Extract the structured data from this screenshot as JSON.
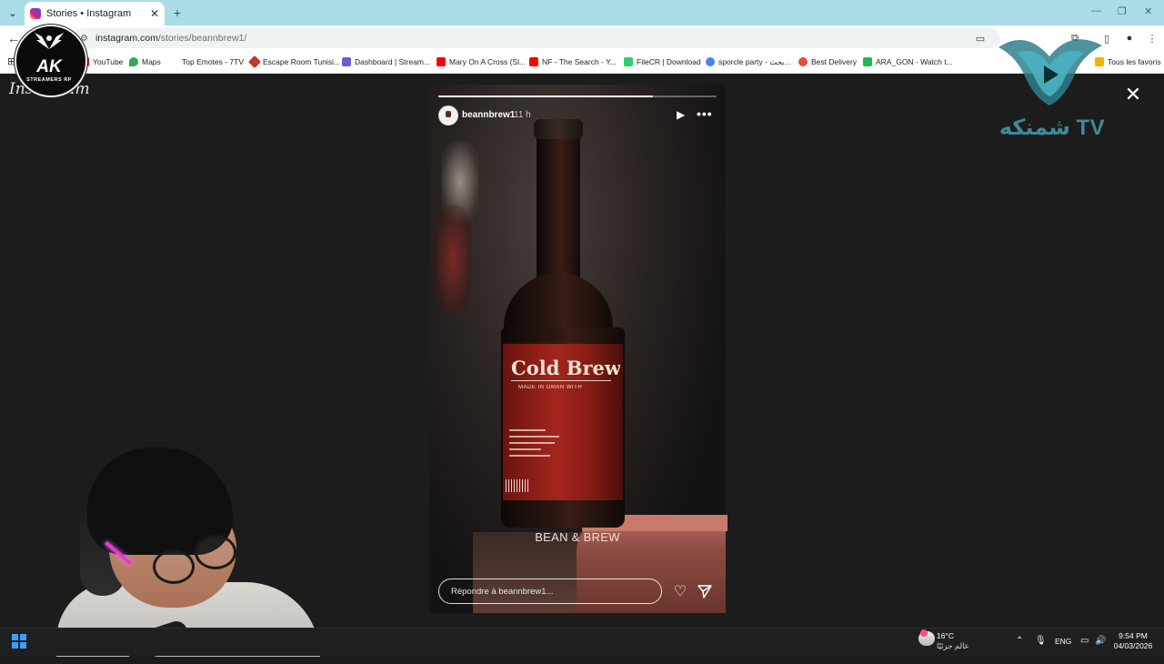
{
  "browser": {
    "tab_title": "Stories • Instagram",
    "tab_close": "✕",
    "new_tab": "+",
    "url_host": "instagram.com",
    "url_path": "/stories/beannbrew1/",
    "bookmarks": [
      {
        "label": "YouTube",
        "color": "#ff0000"
      },
      {
        "label": "Maps",
        "color": "#34a853"
      },
      {
        "label": "Top Emotes - 7TV",
        "color": "#ffffff"
      },
      {
        "label": "Escape Room Tunisi...",
        "color": "#c0392b"
      },
      {
        "label": "Dashboard | Stream...",
        "color": "#6b5bd6"
      },
      {
        "label": "Mary On A Cross (Sl...",
        "color": "#ff0000"
      },
      {
        "label": "NF - The Search - Y...",
        "color": "#ff0000"
      },
      {
        "label": "FileCR | Download",
        "color": "#2ecc71"
      },
      {
        "label": "sporcle party - بحث...",
        "color": "#4285f4"
      },
      {
        "label": "Best Delivery",
        "color": "#e74c3c"
      },
      {
        "label": "ARA_GON - Watch t...",
        "color": "#1db954"
      }
    ],
    "all_bookmarks": "Tous les favoris"
  },
  "instagram": {
    "logo_text": "Instagram",
    "story": {
      "username": "beannbrew1",
      "age": "11 h",
      "progress": 0.77,
      "product_title": "Cold Brew",
      "product_subtitle": "MADE IN OMAN WITH",
      "brand": "BEAN & BREW",
      "reply_placeholder": "Répondre à beannbrew1..."
    },
    "icons": {
      "close": "✕",
      "play": "▶",
      "more": "•••",
      "heart": "♡"
    }
  },
  "overlay": {
    "ak_text": "AK",
    "ak_sub": "STREAMERS RP",
    "tv_text": "شمنكه TV"
  },
  "taskbar": {
    "temperature": "16°C",
    "weather": "عالم جزئيًا",
    "language": "ENG",
    "time": "9:54 PM",
    "date": "04/03/2026"
  }
}
